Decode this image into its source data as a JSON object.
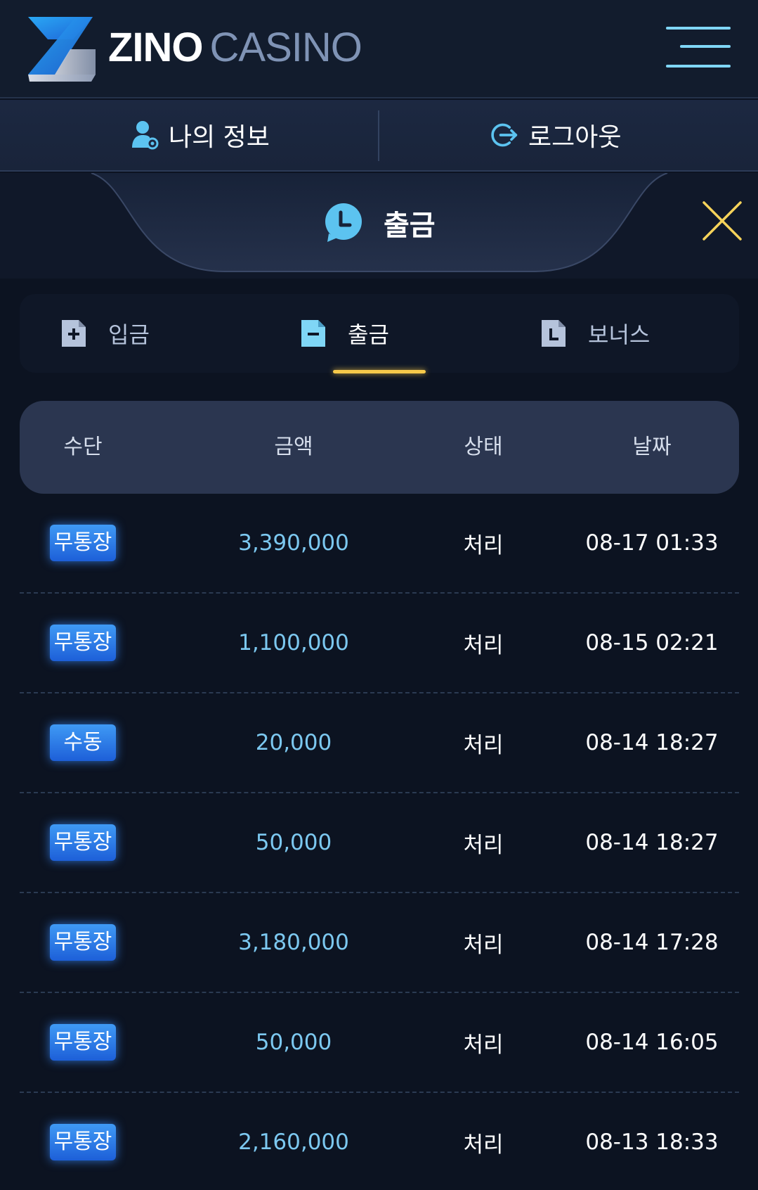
{
  "header": {
    "logo_zino": "ZINO",
    "logo_casino": "CASINO"
  },
  "userbar": {
    "my_info": "나의 정보",
    "logout": "로그아웃"
  },
  "panel": {
    "title": "출금"
  },
  "tabs": [
    {
      "label": "입금",
      "icon": "deposit-plus-icon"
    },
    {
      "label": "출금",
      "icon": "withdraw-minus-icon",
      "active": true
    },
    {
      "label": "보너스",
      "icon": "bonus-document-icon"
    }
  ],
  "table": {
    "headers": [
      "수단",
      "금액",
      "상태",
      "날짜"
    ],
    "rows": [
      {
        "method": "무통장",
        "amount": "3,390,000",
        "status": "처리",
        "date": "08-17 01:33"
      },
      {
        "method": "무통장",
        "amount": "1,100,000",
        "status": "처리",
        "date": "08-15 02:21"
      },
      {
        "method": "수동",
        "amount": "20,000",
        "status": "처리",
        "date": "08-14 18:27"
      },
      {
        "method": "무통장",
        "amount": "50,000",
        "status": "처리",
        "date": "08-14 18:27"
      },
      {
        "method": "무통장",
        "amount": "3,180,000",
        "status": "처리",
        "date": "08-14 17:28"
      },
      {
        "method": "무통장",
        "amount": "50,000",
        "status": "처리",
        "date": "08-14 16:05"
      },
      {
        "method": "무통장",
        "amount": "2,160,000",
        "status": "처리",
        "date": "08-13 18:33"
      }
    ]
  },
  "colors": {
    "accent": "#7cc8f0",
    "tab_underline": "#f6c94a",
    "close_icon": "#f6d35a",
    "badge": "#2f7ef0"
  }
}
